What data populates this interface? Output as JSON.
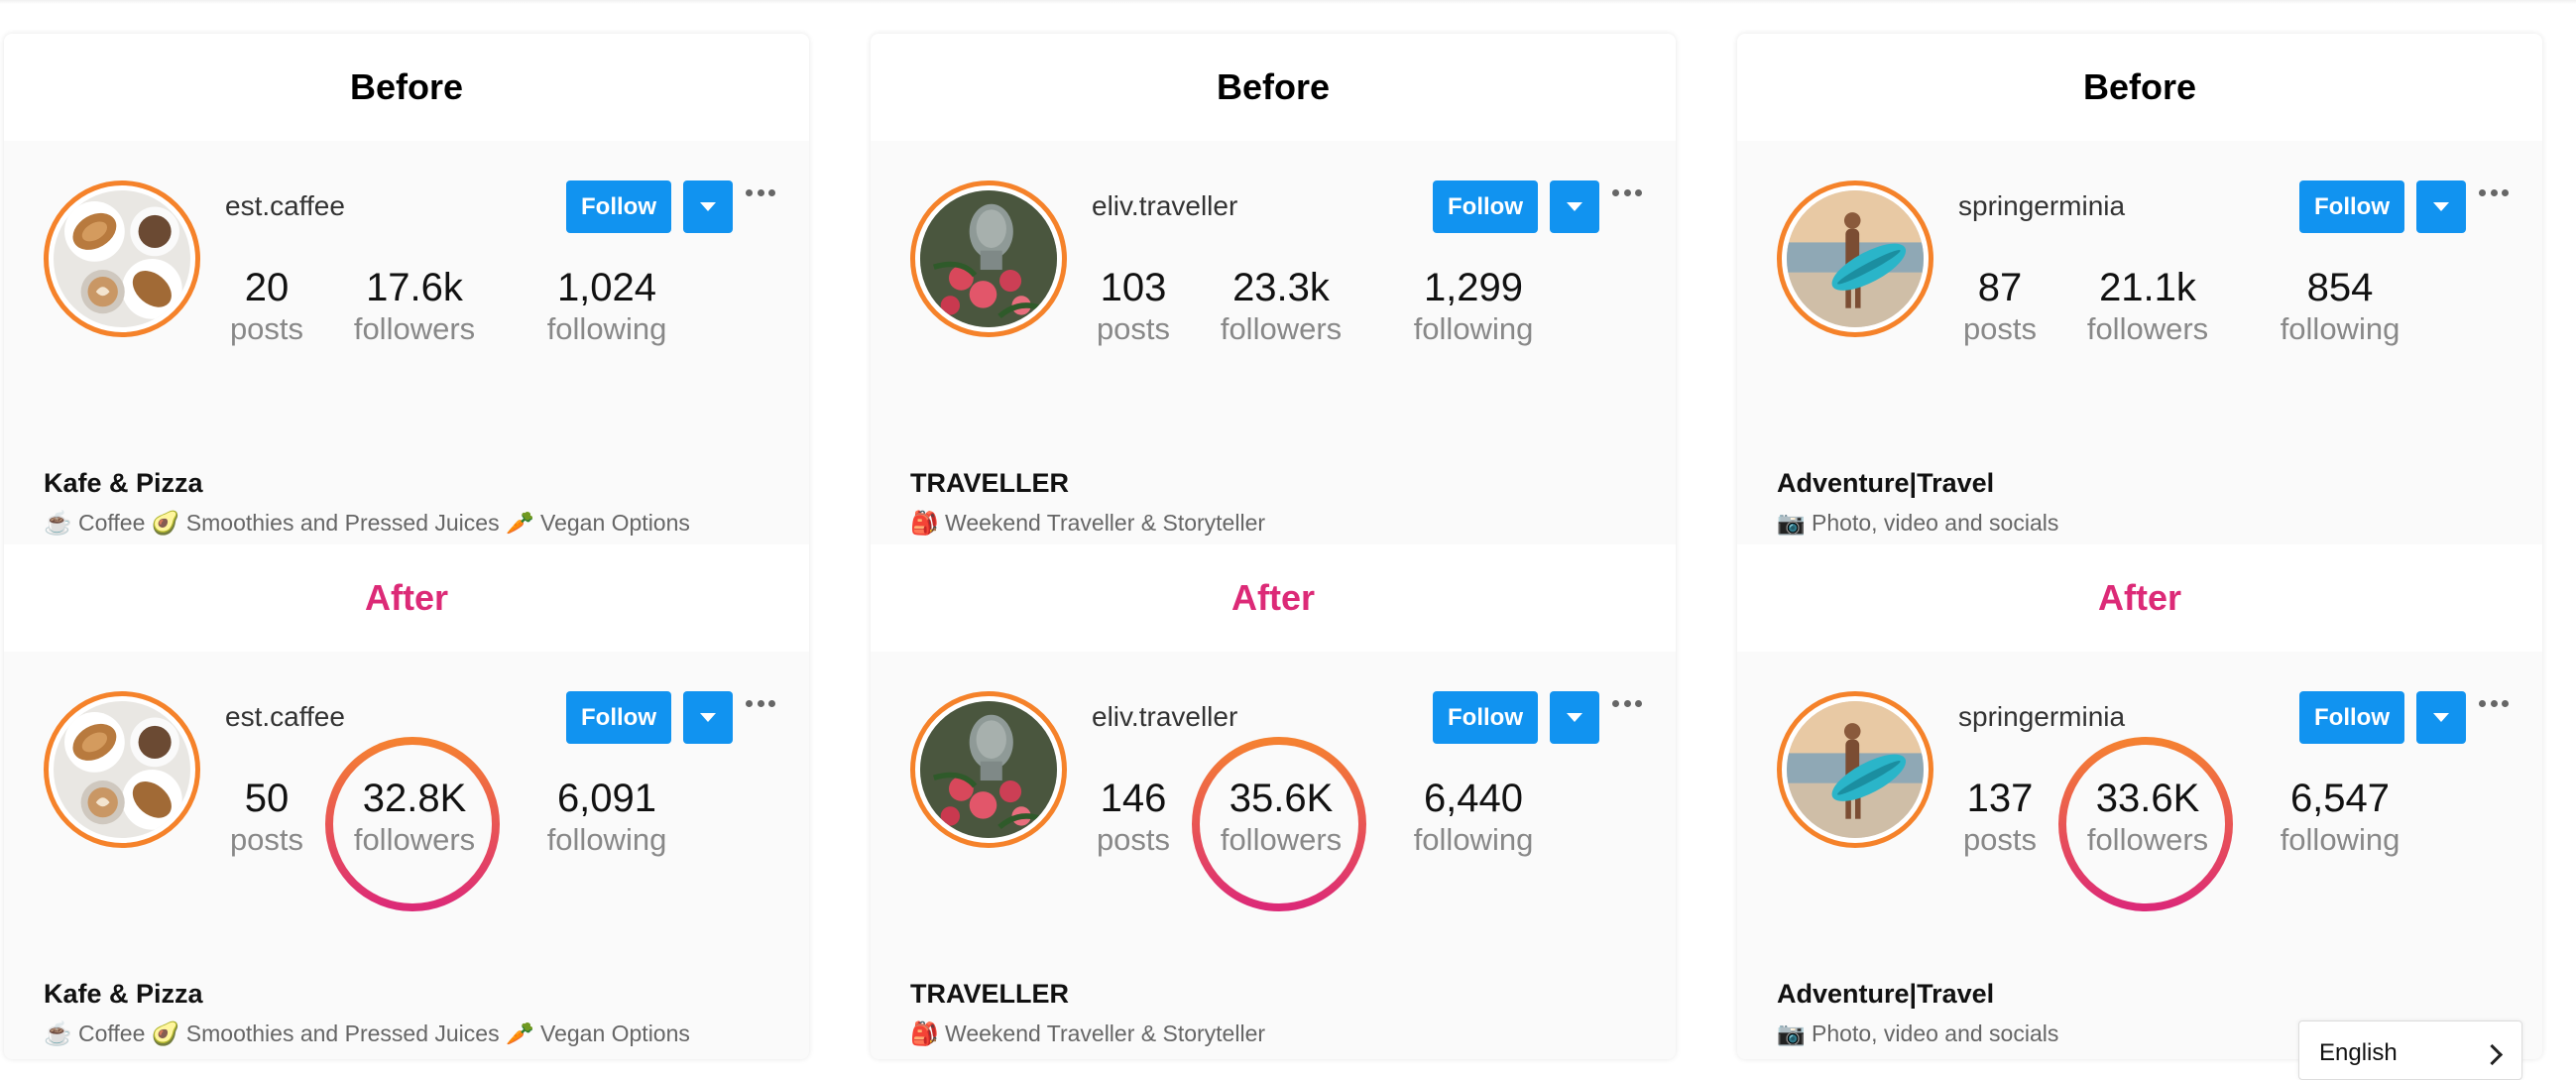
{
  "colors": {
    "accent_blue": "#1193f0",
    "after_pink": "#dc2a77",
    "avatar_ring_orange": "#f5822a",
    "ring_gradient_top": "#f58131",
    "ring_gradient_bottom": "#dc2a77"
  },
  "cards": [
    {
      "avatar_icon": "coffee-croissant-photo",
      "before": {
        "title": "Before",
        "username": "est.caffee",
        "follow_label": "Follow",
        "stats": {
          "posts": {
            "value": "20",
            "label": "posts"
          },
          "followers": {
            "value": "17.6k",
            "label": "followers"
          },
          "following": {
            "value": "1,024",
            "label": "following"
          }
        },
        "bio_name": "Kafe & Pizza",
        "bio_desc": "☕ Coffee 🥑 Smoothies and Pressed Juices 🥕 Vegan Options"
      },
      "after": {
        "title": "After",
        "username": "est.caffee",
        "follow_label": "Follow",
        "stats": {
          "posts": {
            "value": "50",
            "label": "posts"
          },
          "followers": {
            "value": "32.8K",
            "label": "followers"
          },
          "following": {
            "value": "6,091",
            "label": "following"
          }
        },
        "bio_name": "Kafe & Pizza",
        "bio_desc": "☕ Coffee 🥑 Smoothies and Pressed Juices 🥕 Vegan Options"
      }
    },
    {
      "avatar_icon": "statue-roses-photo",
      "before": {
        "title": "Before",
        "username": "eliv.traveller",
        "follow_label": "Follow",
        "stats": {
          "posts": {
            "value": "103",
            "label": "posts"
          },
          "followers": {
            "value": "23.3k",
            "label": "followers"
          },
          "following": {
            "value": "1,299",
            "label": "following"
          }
        },
        "bio_name": "TRAVELLER",
        "bio_desc": "🎒 Weekend Traveller & Storyteller"
      },
      "after": {
        "title": "After",
        "username": "eliv.traveller",
        "follow_label": "Follow",
        "stats": {
          "posts": {
            "value": "146",
            "label": "posts"
          },
          "followers": {
            "value": "35.6K",
            "label": "followers"
          },
          "following": {
            "value": "6,440",
            "label": "following"
          }
        },
        "bio_name": "TRAVELLER",
        "bio_desc": "🎒 Weekend Traveller & Storyteller"
      }
    },
    {
      "avatar_icon": "surfer-beach-photo",
      "before": {
        "title": "Before",
        "username": "springerminia",
        "follow_label": "Follow",
        "stats": {
          "posts": {
            "value": "87",
            "label": "posts"
          },
          "followers": {
            "value": "21.1k",
            "label": "followers"
          },
          "following": {
            "value": "854",
            "label": "following"
          }
        },
        "bio_name": "Adventure|Travel",
        "bio_desc": "📷 Photo, video and socials"
      },
      "after": {
        "title": "After",
        "username": "springerminia",
        "follow_label": "Follow",
        "stats": {
          "posts": {
            "value": "137",
            "label": "posts"
          },
          "followers": {
            "value": "33.6K",
            "label": "followers"
          },
          "following": {
            "value": "6,547",
            "label": "following"
          }
        },
        "bio_name": "Adventure|Travel",
        "bio_desc": "📷 Photo, video and socials"
      }
    }
  ],
  "language_selector": {
    "value": "English",
    "icon": "chevron-right-icon"
  }
}
